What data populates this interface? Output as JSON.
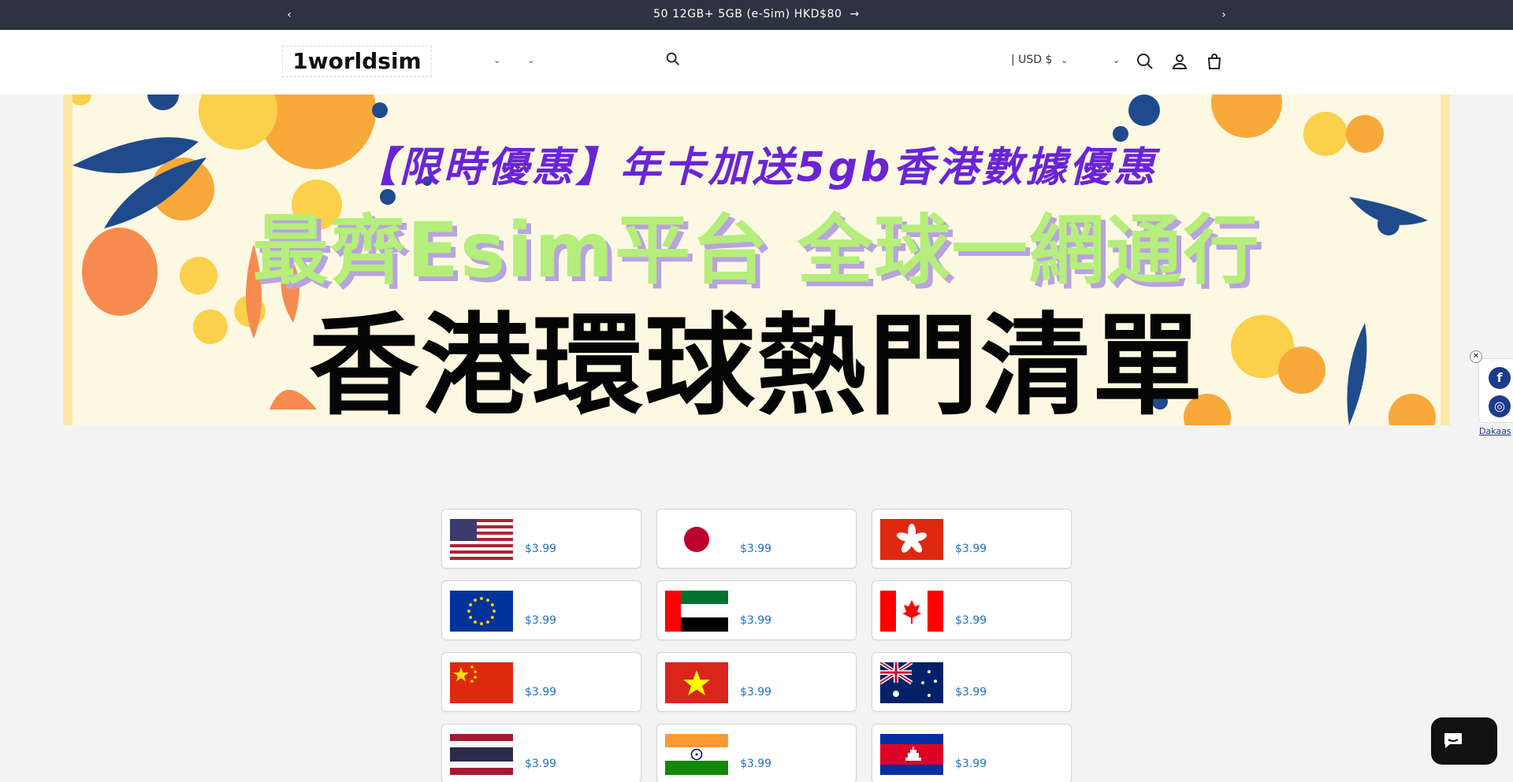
{
  "announcement": {
    "message": "50  12GB+   5GB              (e-Sim)      HKD$80",
    "prev_label": "‹",
    "next_label": "›",
    "go_label": "→"
  },
  "header": {
    "logo": "1worldsim",
    "nav": [
      {
        "label": "",
        "has_dropdown": false
      },
      {
        "label": "",
        "has_dropdown": true
      },
      {
        "label": "",
        "has_dropdown": true
      },
      {
        "label": "",
        "has_dropdown": false
      }
    ],
    "currency": "| USD $",
    "chevron": "⌄"
  },
  "banner": {
    "line1": "【限時優惠】年卡加送5gb香港數據優惠",
    "line2": "最齊Esim平台 全球一網通行",
    "line3": "香港環球熱門清單"
  },
  "social": {
    "close_label": "✕",
    "facebook_label": "f",
    "instagram_label": "◎",
    "credit": "Dakaas"
  },
  "countries": [
    {
      "name": "",
      "price": "$3.99 ",
      "flag": "us"
    },
    {
      "name": "",
      "price": "$3.99 ",
      "flag": "jp"
    },
    {
      "name": "",
      "price": "$3.99 ",
      "flag": "hk"
    },
    {
      "name": "",
      "price": "$3.99 ",
      "flag": "eu"
    },
    {
      "name": "",
      "price": "$3.99 ",
      "flag": "ae"
    },
    {
      "name": "",
      "price": "$3.99 ",
      "flag": "ca"
    },
    {
      "name": "",
      "price": "$3.99 ",
      "flag": "cn"
    },
    {
      "name": "",
      "price": "$3.99 ",
      "flag": "vn"
    },
    {
      "name": "",
      "price": "$3.99 ",
      "flag": "au"
    },
    {
      "name": "",
      "price": "$3.99 ",
      "flag": "th"
    },
    {
      "name": "",
      "price": "$3.99 ",
      "flag": "in"
    },
    {
      "name": "",
      "price": "$3.99 ",
      "flag": "kh"
    }
  ],
  "chat": {
    "label": ""
  },
  "colors": {
    "announcement_bg": "#2d3340",
    "banner_bg": "#fdf8e2",
    "banner_purple": "#6a24d8",
    "banner_green": "#b5ee7a",
    "price_blue": "#1a73c8"
  }
}
